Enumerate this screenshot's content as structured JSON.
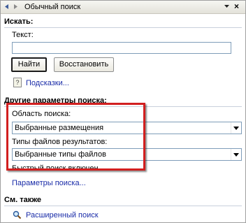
{
  "pane": {
    "title": "Обычный поиск",
    "back_icon": "back-arrow-icon",
    "forward_icon": "forward-arrow-icon",
    "dropdown_icon": "chevron-down-icon",
    "close_icon": "close-icon",
    "close_glyph": "×"
  },
  "search": {
    "header": "Искать:",
    "text_label": "Текст:",
    "text_value": "",
    "find_button": "Найти",
    "restore_button": "Восстановить",
    "tips_link": "Подсказки...",
    "tips_icon": "help-book-icon"
  },
  "options": {
    "header": "Другие параметры поиска:",
    "scope_label": "Область поиска:",
    "scope_value": "Выбранные размещения",
    "filetypes_label": "Типы файлов результатов:",
    "filetypes_value": "Выбранные типы файлов",
    "fast_search_status": "Быстрый поиск включен",
    "search_options_link": "Параметры поиска...",
    "highlight_color": "#d21f1f"
  },
  "see_also": {
    "header": "См. также",
    "advanced_search_link": "Расширенный поиск",
    "advanced_search_icon": "search-icon"
  }
}
